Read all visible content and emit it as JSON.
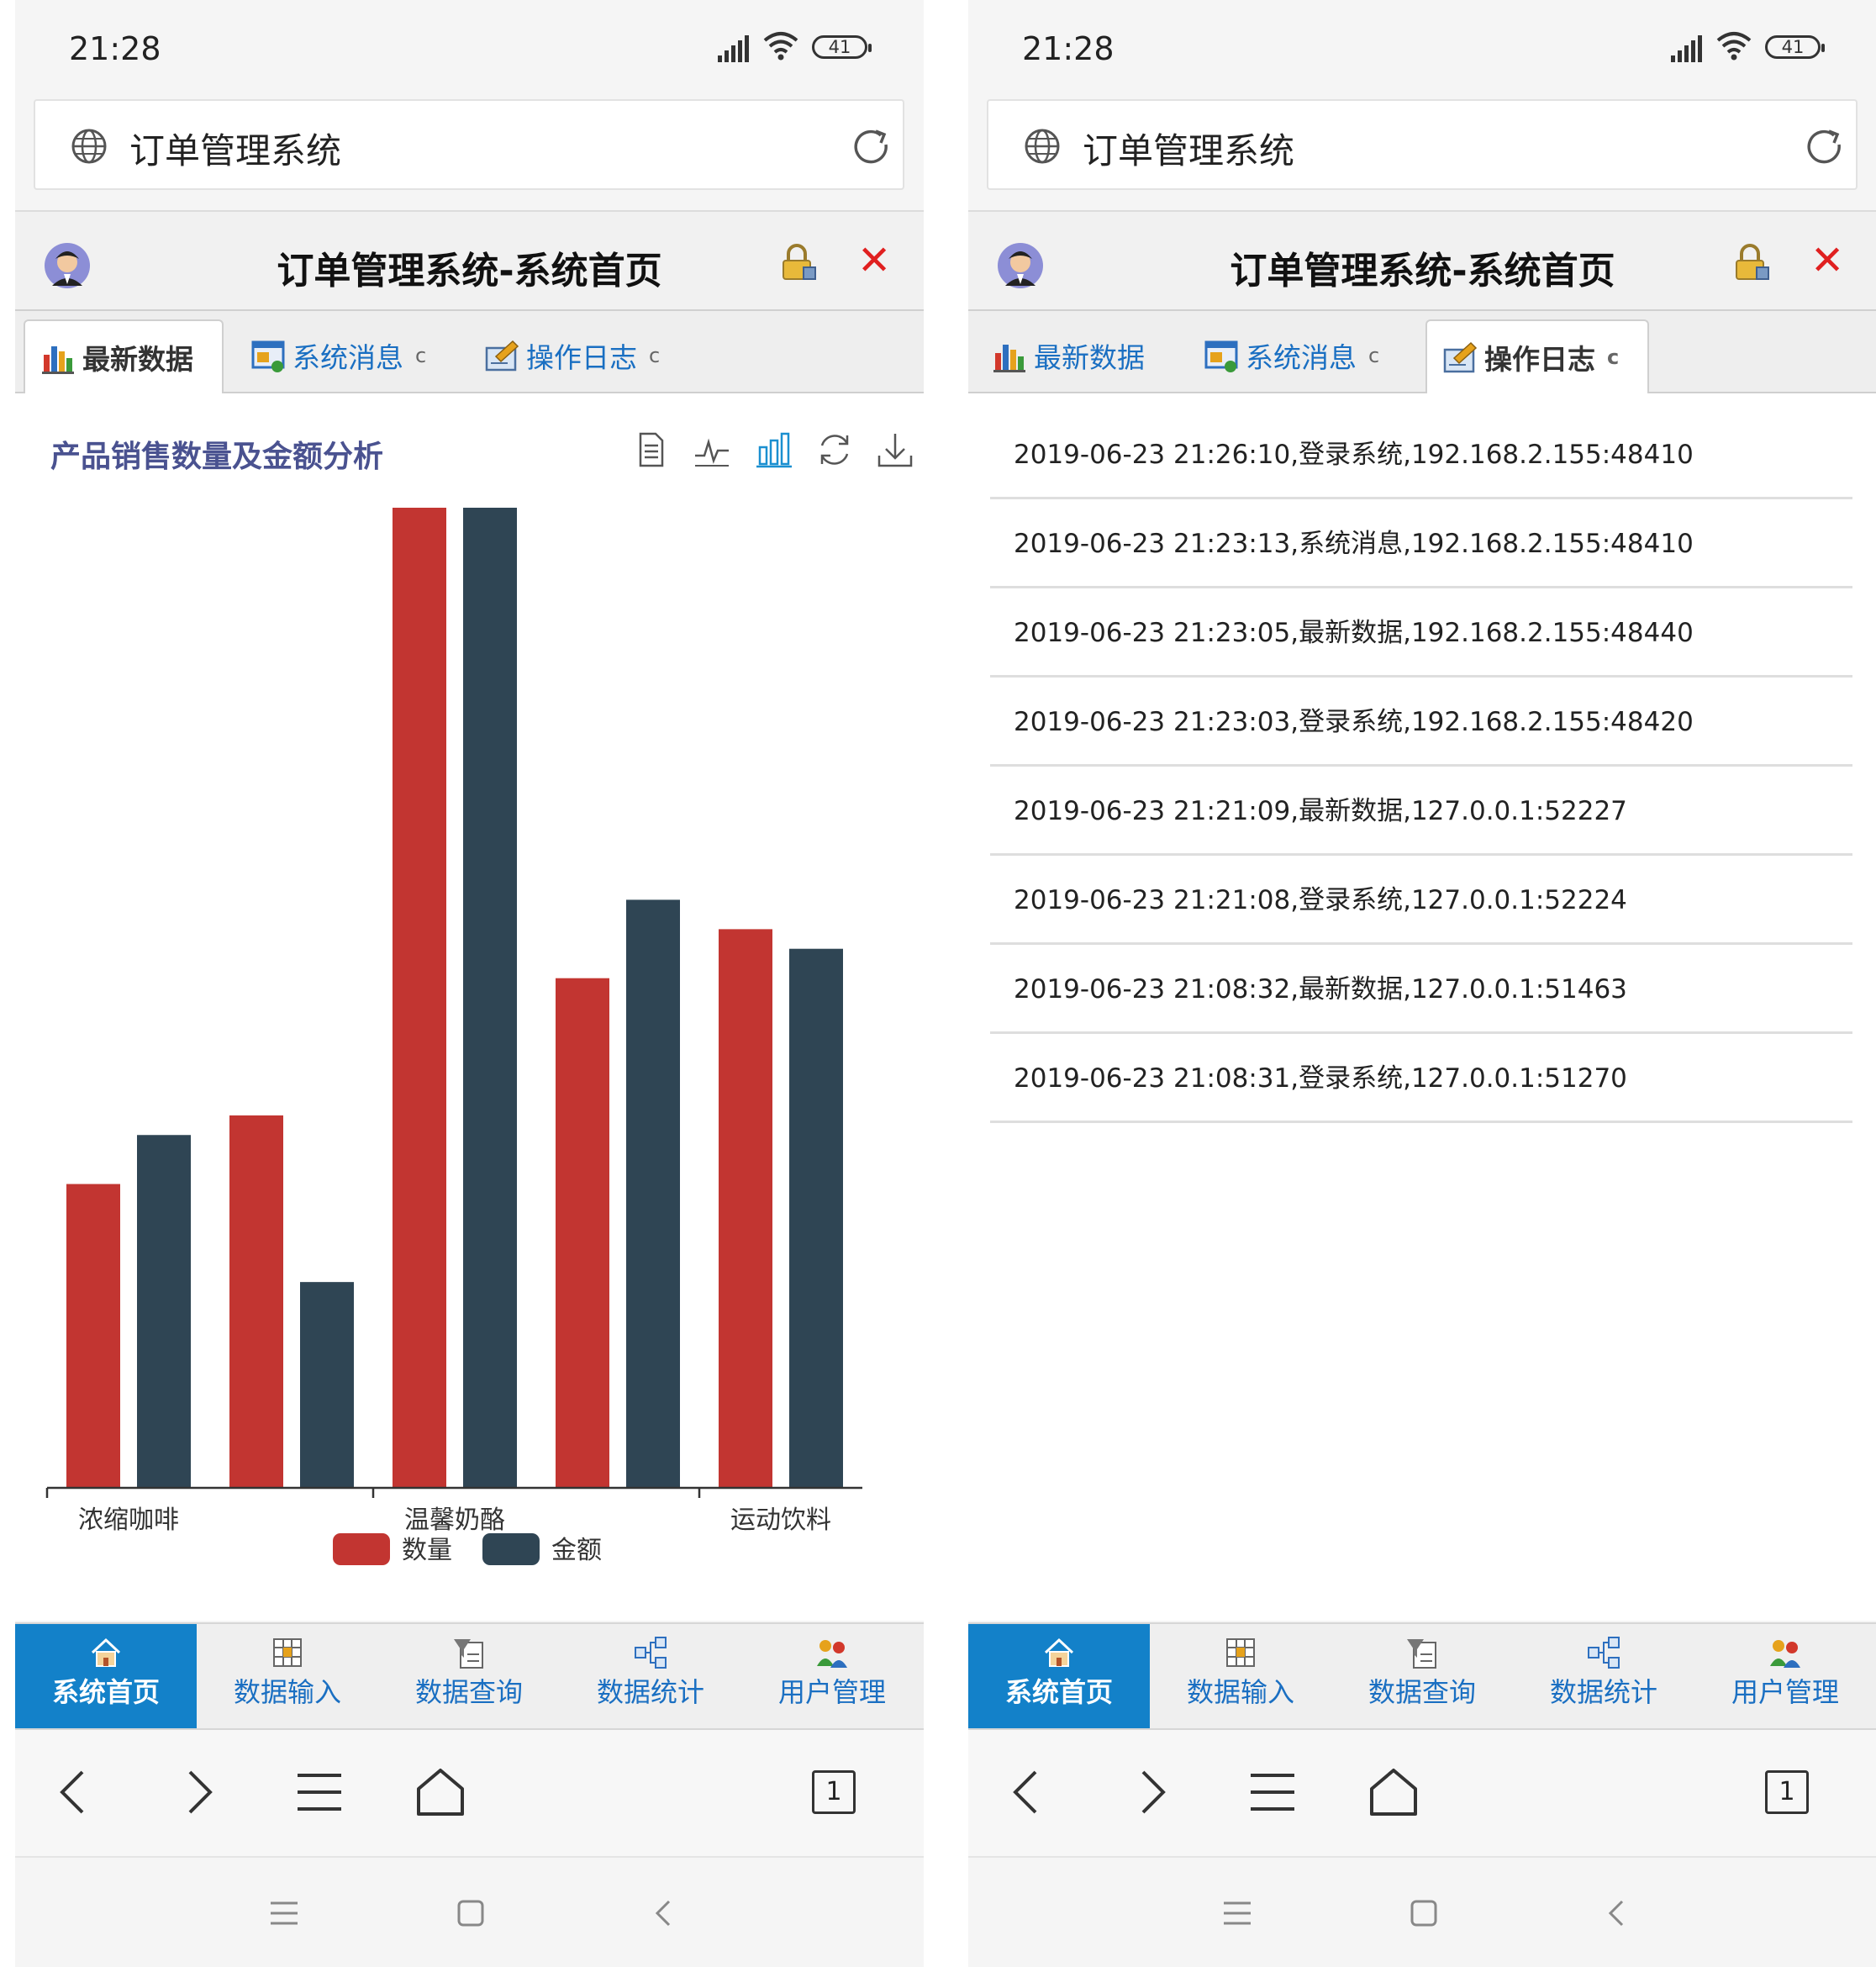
{
  "status_bar": {
    "time": "21:28",
    "battery": "41"
  },
  "browser": {
    "page_title": "订单管理系统",
    "tab_count": "1"
  },
  "app": {
    "title": "订单管理系统-系统首页"
  },
  "tabs": [
    {
      "label": "最新数据",
      "refresh": ""
    },
    {
      "label": "系统消息",
      "refresh": "c"
    },
    {
      "label": "操作日志",
      "refresh": "c"
    }
  ],
  "chart_data": {
    "type": "bar",
    "title": "产品销售数量及金额分析",
    "categories": [
      "浓缩咖啡",
      "",
      "温馨奶酪",
      "",
      "运动饮料"
    ],
    "series": [
      {
        "name": "数量",
        "values": [
          31,
          38,
          100,
          52,
          57
        ],
        "color": "#c23531"
      },
      {
        "name": "金额",
        "values": [
          36,
          21,
          100,
          60,
          55
        ],
        "color": "#2f4554"
      }
    ],
    "ylim": [
      0,
      100
    ],
    "xlabel": "",
    "ylabel": "",
    "legend": "bottom-center",
    "grid": false
  },
  "log_entries": [
    "2019-06-23 21:26:10,登录系统,192.168.2.155:48410",
    "2019-06-23 21:23:13,系统消息,192.168.2.155:48410",
    "2019-06-23 21:23:05,最新数据,192.168.2.155:48440",
    "2019-06-23 21:23:03,登录系统,192.168.2.155:48420",
    "2019-06-23 21:21:09,最新数据,127.0.0.1:52227",
    "2019-06-23 21:21:08,登录系统,127.0.0.1:52224",
    "2019-06-23 21:08:32,最新数据,127.0.0.1:51463",
    "2019-06-23 21:08:31,登录系统,127.0.0.1:51270"
  ],
  "bottom_nav": [
    {
      "label": "系统首页",
      "icon": "home-icon"
    },
    {
      "label": "数据输入",
      "icon": "grid-input-icon"
    },
    {
      "label": "数据查询",
      "icon": "query-icon"
    },
    {
      "label": "数据统计",
      "icon": "stats-icon"
    },
    {
      "label": "用户管理",
      "icon": "users-icon"
    }
  ],
  "colors": {
    "accent": "#1381c9",
    "link": "#1a6fc2",
    "close": "#e02020",
    "chart_title": "#4a5290"
  }
}
